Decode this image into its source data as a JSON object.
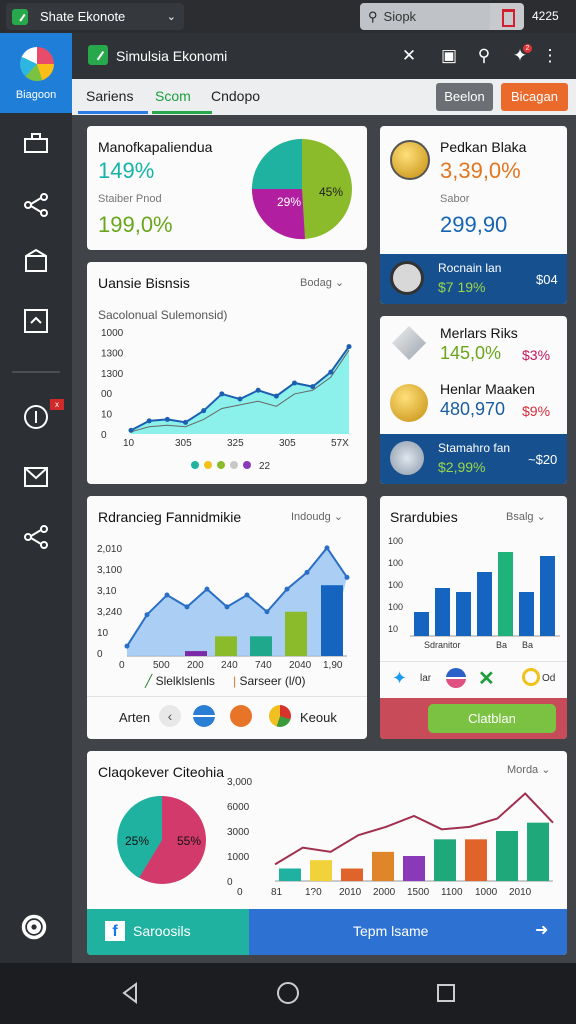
{
  "topbar": {
    "tab_title": "Shate Ekonote",
    "search_value": "Siopk",
    "clock": "4225"
  },
  "sidebar": {
    "brand": "Biagoon",
    "icons": [
      "briefcase-icon",
      "share-icon",
      "box-icon",
      "image-icon",
      "info-icon",
      "mail-icon",
      "share-icon",
      "target-icon"
    ],
    "notif_badge": "x"
  },
  "header": {
    "title": "Simulsia Ekonomi",
    "badge": "2"
  },
  "subnav": {
    "tabs": [
      "Sariens",
      "Scom",
      "Cndopo"
    ],
    "btn_grey": "Beelon",
    "btn_orange": "Bicagan"
  },
  "card1": {
    "title": "Manofkapaliendua",
    "value1": "149%",
    "label2": "Staiber Pnod",
    "value2": "199,0%",
    "pie": {
      "s1": "29%",
      "s2": "45%"
    }
  },
  "card2": {
    "title": "Pedkan Blaka",
    "value1": "3,39,0%",
    "label2": "Sabor",
    "value2": "299,90",
    "strip_label": "Rocnain lan",
    "strip_value": "$7 19%",
    "strip_right": "$04"
  },
  "card3": {
    "title": "Uansie Bisnsis",
    "dropdown": "Bodag",
    "subtitle": "Sacolonual Sulemonsid)",
    "legend_extra": "22",
    "chart_data": {
      "type": "area",
      "y_ticks": [
        "1000",
        "1300",
        "1300",
        "00",
        "10",
        "0"
      ],
      "x_ticks": [
        "10",
        "305",
        "325",
        "305",
        "57X"
      ],
      "series": [
        {
          "values": [
            5,
            18,
            20,
            16,
            32,
            55,
            48,
            60,
            52,
            70,
            65,
            85,
            120
          ]
        },
        {
          "values": [
            3,
            10,
            12,
            10,
            20,
            35,
            40,
            45,
            38,
            55,
            60,
            78,
            115
          ]
        }
      ],
      "ylim": [
        0,
        140
      ]
    }
  },
  "card4": {
    "items": [
      {
        "title": "Merlars Riks",
        "value": "145,0%",
        "right": "$3%"
      },
      {
        "title": "Henlar Maaken",
        "value": "480,970",
        "right": "$9%"
      }
    ],
    "strip_label": "Stamahro fan",
    "strip_value": "$2,99%",
    "strip_right": "~$20"
  },
  "card5": {
    "title": "Rdrancieg Fannidmikie",
    "dropdown": "Indoudg",
    "legend1": "Slelklslenls",
    "legend2": "Sarseer (l/0)",
    "footer_label": "Arten",
    "footer_right": "Keouk",
    "chart_data": {
      "type": "area",
      "y_ticks": [
        "2,010",
        "3,100",
        "3,10",
        "3,240",
        "10",
        "0"
      ],
      "x_ticks": [
        "0",
        "500",
        "200",
        "240",
        "740",
        "2040",
        "1,90"
      ],
      "area": [
        10,
        42,
        62,
        50,
        68,
        50,
        62,
        45,
        68,
        85,
        110,
        80
      ],
      "bars": [
        {
          "value": 5,
          "color": "#7b2aa8"
        },
        {
          "value": 20,
          "color": "#8bbb2a"
        },
        {
          "value": 20,
          "color": "#1fa88c"
        },
        {
          "value": 45,
          "color": "#8bbb2a"
        },
        {
          "value": 72,
          "color": "#1565c0"
        }
      ],
      "ylim": [
        0,
        120
      ]
    }
  },
  "card6": {
    "title": "Srardubies",
    "dropdown": "Bsalg",
    "x_labels": [
      "Sdranitor",
      "Ba",
      "Ba"
    ],
    "social": [
      "lar",
      "Od"
    ],
    "button": "Clatblan",
    "chart_data": {
      "type": "bar",
      "y_ticks": [
        "100",
        "100",
        "100",
        "100",
        "10"
      ],
      "values": [
        30,
        60,
        55,
        80,
        105,
        55,
        100
      ],
      "colors": [
        "#1565c0",
        "#1565c0",
        "#1565c0",
        "#1565c0",
        "#1fb27a",
        "#1565c0",
        "#1565c0"
      ],
      "ylim": [
        0,
        120
      ]
    }
  },
  "card7": {
    "title": "Claqokever Citeohia",
    "dropdown": "Morda",
    "pie": {
      "s1": "25%",
      "s2": "55%"
    },
    "footer_left": "Saroosils",
    "footer_right": "Tepm lsame",
    "chart_data": {
      "type": "bar",
      "y_ticks": [
        "3,000",
        "6000",
        "3000",
        "1000",
        "0"
      ],
      "x_ticks": [
        "0",
        "81",
        "1?0",
        "2010",
        "2000",
        "1500",
        "1100",
        "1000",
        "2010"
      ],
      "values": [
        15,
        25,
        15,
        35,
        30,
        50,
        50,
        60,
        70
      ],
      "colors": [
        "#1fb2a0",
        "#f2d23a",
        "#e0642a",
        "#e0862a",
        "#8a3ab8",
        "#1fa87a",
        "#e0642a",
        "#1fa87a",
        "#1fa87a"
      ],
      "line": [
        20,
        40,
        35,
        55,
        65,
        78,
        62,
        65,
        75,
        105,
        70
      ],
      "ylim": [
        0,
        120
      ]
    }
  }
}
